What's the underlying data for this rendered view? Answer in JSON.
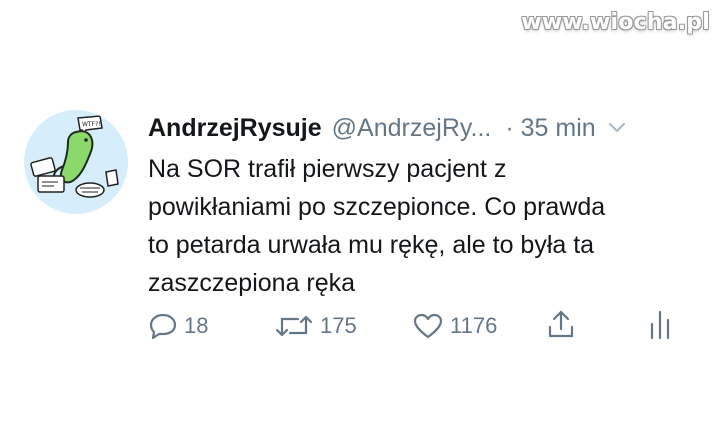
{
  "watermark": "www.wiocha.pl",
  "tweet": {
    "display_name": "AndrzejRysuje",
    "handle": "@AndrzejRy...",
    "time": "· 35 min",
    "text_lines": [
      "Na SOR trafił pierwszy pacjent z",
      "powikłaniami po szczepionce. Co prawda",
      "to petarda urwała mu rękę, ale to była ta",
      "zaszczepiona ręka"
    ],
    "avatar_label": "WTF?!"
  },
  "actions": {
    "replies": "18",
    "retweets": "175",
    "likes": "1176"
  },
  "colors": {
    "text": "#14171a",
    "secondary": "#657786",
    "avatar_bg": "#d6eefb",
    "avatar_figure": "#8cd96b"
  },
  "icons": [
    "reply-icon",
    "retweet-icon",
    "like-icon",
    "share-icon",
    "analytics-icon",
    "chevron-down-icon"
  ]
}
